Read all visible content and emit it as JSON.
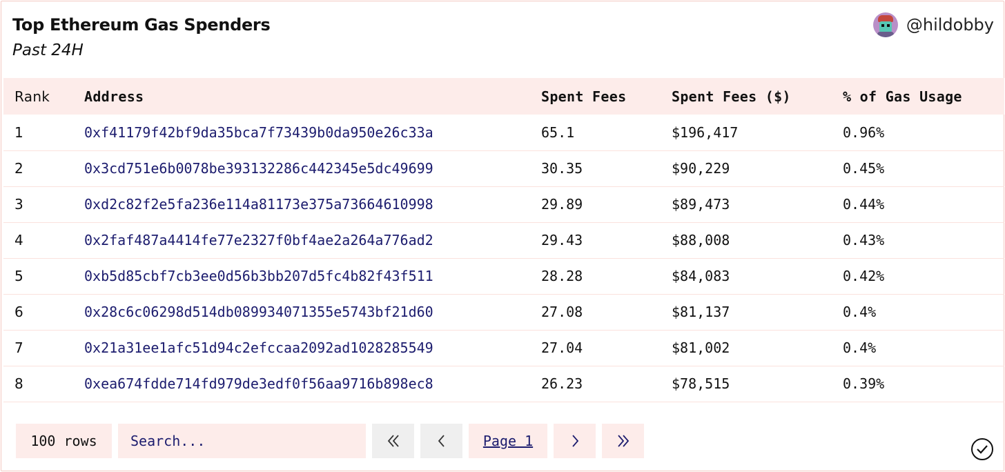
{
  "header": {
    "title": "Top Ethereum Gas Spenders",
    "subtitle": "Past 24H",
    "author": "@hildobby"
  },
  "table": {
    "columns": [
      "Rank",
      "Address",
      "Spent Fees",
      "Spent Fees ($)",
      "% of Gas Usage"
    ],
    "rows": [
      {
        "rank": "1",
        "address": "0xf41179f42bf9da35bca7f73439b0da950e26c33a",
        "fees": "65.1",
        "usd": "$196,417",
        "pct": "0.96%"
      },
      {
        "rank": "2",
        "address": "0x3cd751e6b0078be393132286c442345e5dc49699",
        "fees": "30.35",
        "usd": "$90,229",
        "pct": "0.45%"
      },
      {
        "rank": "3",
        "address": "0xd2c82f2e5fa236e114a81173e375a73664610998",
        "fees": "29.89",
        "usd": "$89,473",
        "pct": "0.44%"
      },
      {
        "rank": "4",
        "address": "0x2faf487a4414fe77e2327f0bf4ae2a264a776ad2",
        "fees": "29.43",
        "usd": "$88,008",
        "pct": "0.43%"
      },
      {
        "rank": "5",
        "address": "0xb5d85cbf7cb3ee0d56b3bb207d5fc4b82f43f511",
        "fees": "28.28",
        "usd": "$84,083",
        "pct": "0.42%"
      },
      {
        "rank": "6",
        "address": "0x28c6c06298d514db089934071355e5743bf21d60",
        "fees": "27.08",
        "usd": "$81,137",
        "pct": "0.4%"
      },
      {
        "rank": "7",
        "address": "0x21a31ee1afc51d94c2efccaa2092ad1028285549",
        "fees": "27.04",
        "usd": "$81,002",
        "pct": "0.4%"
      },
      {
        "rank": "8",
        "address": "0xea674fdde714fd979de3edf0f56aa9716b898ec8",
        "fees": "26.23",
        "usd": "$78,515",
        "pct": "0.39%"
      }
    ]
  },
  "footer": {
    "rows_label": "100 rows",
    "search_placeholder": "Search...",
    "page_label": "Page 1"
  },
  "colors": {
    "accent_bg": "#fdecea",
    "link": "#1c1c6e",
    "border": "#f3c9c2"
  },
  "icons": {
    "first": "double-chevron-left-icon",
    "prev": "chevron-left-icon",
    "next": "chevron-right-icon",
    "last": "double-chevron-right-icon",
    "status": "check-circle-icon"
  }
}
